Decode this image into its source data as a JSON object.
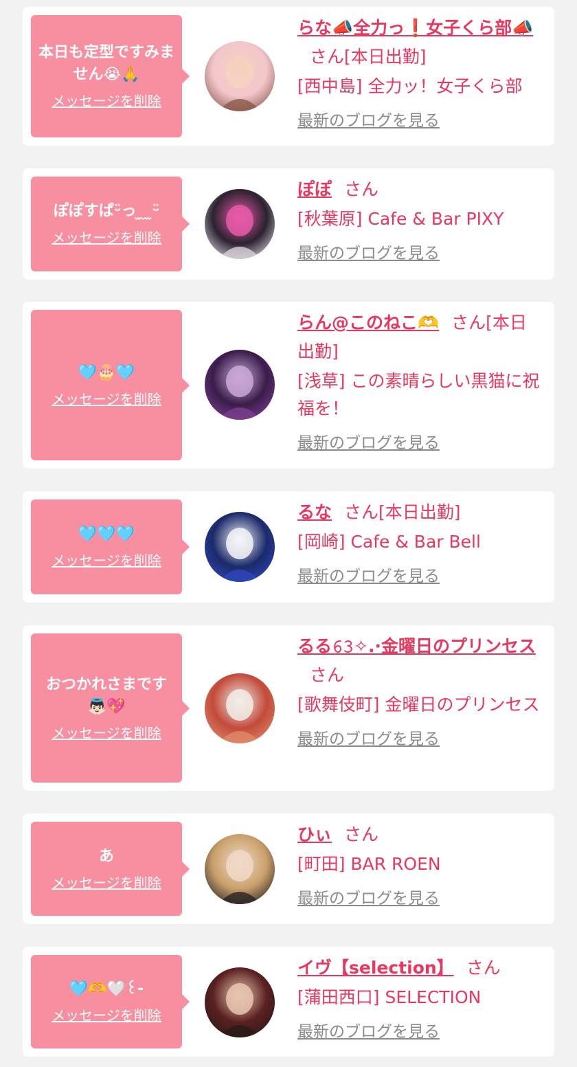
{
  "delete_label": "メッセージを削除",
  "blog_label": "最新のブログを見る",
  "san_label": "さん",
  "cards": [
    {
      "message": "本日も定型ですみません😭🙏",
      "name": "らな📣全力っ❗️女子くら部📣",
      "suffix": "さん[本日出勤]",
      "shop": "[西中島] 全力ッ！女子くら部",
      "avatar_colors": [
        "#f3c6cc",
        "#8a5a4a",
        "#f5d2c0"
      ]
    },
    {
      "message": "ぽぽすぱᵕ̈っ ̫ ̮ ̫ᵕ̈",
      "name": "ぽぽ",
      "suffix": "さん",
      "shop": "[秋葉原] Cafe & Bar PIXY",
      "avatar_colors": [
        "#2b2230",
        "#d9d2dc",
        "#e85aa8"
      ]
    },
    {
      "message": "🩵🎂🩵",
      "name": "らん@このねこ🫶",
      "suffix": "さん[本日出勤]",
      "shop": "[浅草] この素晴らしい黒猫に祝福を！",
      "avatar_colors": [
        "#3a1c4a",
        "#7a3f8f",
        "#c9a8d8"
      ]
    },
    {
      "message": "🩵🩵🩵",
      "name": "るな",
      "suffix": "さん[本日出勤]",
      "shop": "[岡崎] Cafe & Bar Bell",
      "avatar_colors": [
        "#1b2a6a",
        "#3046b8",
        "#f4f4f8"
      ]
    },
    {
      "message": "おつかれさまです👼🏻💖",
      "name": "るる𝟼𝟹✧.·金曜日のプリンセス",
      "suffix": "さん",
      "shop": "[歌舞伎町] 金曜日のプリンセス",
      "avatar_colors": [
        "#c24a3a",
        "#e08a6a",
        "#f2ece8"
      ]
    },
    {
      "message": "あ",
      "name": "ひぃ",
      "suffix": "さん",
      "shop": "[町田] BAR ROEN",
      "avatar_colors": [
        "#c9a06a",
        "#2a2326",
        "#f1d9c8"
      ]
    },
    {
      "message": "🩵🫶🤍꒰-",
      "name": "イヴ【selection】",
      "suffix": "さん",
      "shop": "[蒲田西口] SELECTION",
      "avatar_colors": [
        "#5a2020",
        "#2a1a1a",
        "#e9c6b0"
      ]
    }
  ]
}
